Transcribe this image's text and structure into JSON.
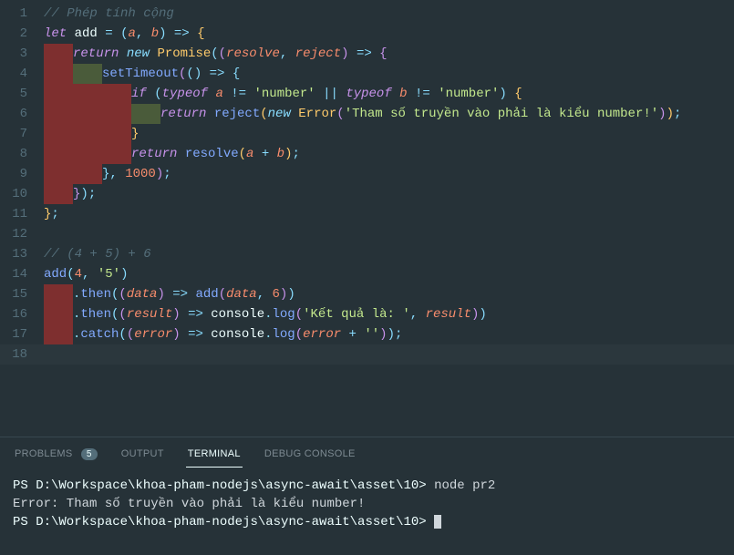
{
  "editor": {
    "lines": [
      {
        "n": 1,
        "segs": [
          [
            "comment",
            "// Phép tính cộng"
          ]
        ]
      },
      {
        "n": 2,
        "segs": [
          [
            "keyword",
            "let"
          ],
          [
            "sp",
            " "
          ],
          [
            "var",
            "add"
          ],
          [
            "sp",
            " "
          ],
          [
            "op",
            "="
          ],
          [
            "sp",
            " "
          ],
          [
            "punct",
            "("
          ],
          [
            "param",
            "a"
          ],
          [
            "punct",
            ","
          ],
          [
            "sp",
            " "
          ],
          [
            "param",
            "b"
          ],
          [
            "punct",
            ")"
          ],
          [
            "sp",
            " "
          ],
          [
            "op",
            "=>"
          ],
          [
            "sp",
            " "
          ],
          [
            "brace",
            "{"
          ]
        ]
      },
      {
        "n": 3,
        "indent": 1,
        "segs": [
          [
            "dirty1",
            1
          ],
          [
            "keyword",
            "return"
          ],
          [
            "sp",
            " "
          ],
          [
            "new",
            "new"
          ],
          [
            "sp",
            " "
          ],
          [
            "class",
            "Promise"
          ],
          [
            "punct",
            "("
          ],
          [
            "brace2",
            "("
          ],
          [
            "param",
            "resolve"
          ],
          [
            "punct",
            ","
          ],
          [
            "sp",
            " "
          ],
          [
            "param",
            "reject"
          ],
          [
            "brace2",
            ")"
          ],
          [
            "sp",
            " "
          ],
          [
            "op",
            "=>"
          ],
          [
            "sp",
            " "
          ],
          [
            "brace2",
            "{"
          ]
        ]
      },
      {
        "n": 4,
        "indent": 2,
        "segs": [
          [
            "dirty12",
            2
          ],
          [
            "func",
            "setTimeout"
          ],
          [
            "brace2",
            "("
          ],
          [
            "brace3",
            "("
          ],
          [
            "brace3",
            ")"
          ],
          [
            "sp",
            " "
          ],
          [
            "op",
            "=>"
          ],
          [
            "sp",
            " "
          ],
          [
            "brace3",
            "{"
          ]
        ]
      },
      {
        "n": 5,
        "indent": 3,
        "segs": [
          [
            "dirty1",
            3
          ],
          [
            "keyword",
            "if"
          ],
          [
            "sp",
            " "
          ],
          [
            "brace3",
            "("
          ],
          [
            "keyword",
            "typeof"
          ],
          [
            "sp",
            " "
          ],
          [
            "param",
            "a"
          ],
          [
            "sp",
            " "
          ],
          [
            "op",
            "!="
          ],
          [
            "sp",
            " "
          ],
          [
            "string",
            "'number'"
          ],
          [
            "sp",
            " "
          ],
          [
            "op",
            "||"
          ],
          [
            "sp",
            " "
          ],
          [
            "keyword",
            "typeof"
          ],
          [
            "sp",
            " "
          ],
          [
            "param",
            "b"
          ],
          [
            "sp",
            " "
          ],
          [
            "op",
            "!="
          ],
          [
            "sp",
            " "
          ],
          [
            "string",
            "'number'"
          ],
          [
            "brace3",
            ")"
          ],
          [
            "sp",
            " "
          ],
          [
            "brace",
            "{"
          ]
        ]
      },
      {
        "n": 6,
        "indent": 4,
        "segs": [
          [
            "dirty12",
            4
          ],
          [
            "keyword",
            "return"
          ],
          [
            "sp",
            " "
          ],
          [
            "func",
            "reject"
          ],
          [
            "brace",
            "("
          ],
          [
            "new",
            "new"
          ],
          [
            "sp",
            " "
          ],
          [
            "class",
            "Error"
          ],
          [
            "brace2",
            "("
          ],
          [
            "string",
            "'Tham số truyền vào phải là kiểu number!'"
          ],
          [
            "brace2",
            ")"
          ],
          [
            "brace",
            ")"
          ],
          [
            "punct",
            ";"
          ]
        ]
      },
      {
        "n": 7,
        "indent": 3,
        "segs": [
          [
            "dirty1",
            3
          ],
          [
            "brace",
            "}"
          ]
        ]
      },
      {
        "n": 8,
        "indent": 3,
        "segs": [
          [
            "dirty1",
            3
          ],
          [
            "keyword",
            "return"
          ],
          [
            "sp",
            " "
          ],
          [
            "func",
            "resolve"
          ],
          [
            "brace",
            "("
          ],
          [
            "param",
            "a"
          ],
          [
            "sp",
            " "
          ],
          [
            "op",
            "+"
          ],
          [
            "sp",
            " "
          ],
          [
            "param",
            "b"
          ],
          [
            "brace",
            ")"
          ],
          [
            "punct",
            ";"
          ]
        ]
      },
      {
        "n": 9,
        "indent": 2,
        "segs": [
          [
            "dirty1",
            2
          ],
          [
            "brace3",
            "}"
          ],
          [
            "punct",
            ","
          ],
          [
            "sp",
            " "
          ],
          [
            "num",
            "1000"
          ],
          [
            "brace2",
            ")"
          ],
          [
            "punct",
            ";"
          ]
        ]
      },
      {
        "n": 10,
        "indent": 1,
        "segs": [
          [
            "dirty1",
            1
          ],
          [
            "brace2",
            "}"
          ],
          [
            "punct",
            ")"
          ],
          [
            "punct",
            ";"
          ]
        ]
      },
      {
        "n": 11,
        "segs": [
          [
            "brace",
            "}"
          ],
          [
            "punct",
            ";"
          ]
        ]
      },
      {
        "n": 12,
        "segs": []
      },
      {
        "n": 13,
        "segs": [
          [
            "comment",
            "// (4 + 5) + 6"
          ]
        ]
      },
      {
        "n": 14,
        "segs": [
          [
            "func",
            "add"
          ],
          [
            "punct",
            "("
          ],
          [
            "num",
            "4"
          ],
          [
            "punct",
            ","
          ],
          [
            "sp",
            " "
          ],
          [
            "string",
            "'5'"
          ],
          [
            "punct",
            ")"
          ]
        ]
      },
      {
        "n": 15,
        "indent": 1,
        "segs": [
          [
            "dirty1",
            1
          ],
          [
            "punct",
            "."
          ],
          [
            "func",
            "then"
          ],
          [
            "punct",
            "("
          ],
          [
            "brace2",
            "("
          ],
          [
            "param",
            "data"
          ],
          [
            "brace2",
            ")"
          ],
          [
            "sp",
            " "
          ],
          [
            "op",
            "=>"
          ],
          [
            "sp",
            " "
          ],
          [
            "func",
            "add"
          ],
          [
            "brace2",
            "("
          ],
          [
            "param",
            "data"
          ],
          [
            "punct",
            ","
          ],
          [
            "sp",
            " "
          ],
          [
            "num",
            "6"
          ],
          [
            "brace2",
            ")"
          ],
          [
            "punct",
            ")"
          ]
        ]
      },
      {
        "n": 16,
        "indent": 1,
        "segs": [
          [
            "dirty1",
            1
          ],
          [
            "punct",
            "."
          ],
          [
            "func",
            "then"
          ],
          [
            "punct",
            "("
          ],
          [
            "brace2",
            "("
          ],
          [
            "param",
            "result"
          ],
          [
            "brace2",
            ")"
          ],
          [
            "sp",
            " "
          ],
          [
            "op",
            "=>"
          ],
          [
            "sp",
            " "
          ],
          [
            "var",
            "console"
          ],
          [
            "punct",
            "."
          ],
          [
            "func",
            "log"
          ],
          [
            "brace2",
            "("
          ],
          [
            "string",
            "'Kết quả là: '"
          ],
          [
            "punct",
            ","
          ],
          [
            "sp",
            " "
          ],
          [
            "param",
            "result"
          ],
          [
            "brace2",
            ")"
          ],
          [
            "punct",
            ")"
          ]
        ]
      },
      {
        "n": 17,
        "indent": 1,
        "segs": [
          [
            "dirty1",
            1
          ],
          [
            "punct",
            "."
          ],
          [
            "func",
            "catch"
          ],
          [
            "punct",
            "("
          ],
          [
            "brace2",
            "("
          ],
          [
            "param",
            "error"
          ],
          [
            "brace2",
            ")"
          ],
          [
            "sp",
            " "
          ],
          [
            "op",
            "=>"
          ],
          [
            "sp",
            " "
          ],
          [
            "var",
            "console"
          ],
          [
            "punct",
            "."
          ],
          [
            "func",
            "log"
          ],
          [
            "brace2",
            "("
          ],
          [
            "param",
            "error"
          ],
          [
            "sp",
            " "
          ],
          [
            "op",
            "+"
          ],
          [
            "sp",
            " "
          ],
          [
            "string",
            "''"
          ],
          [
            "brace2",
            ")"
          ],
          [
            "punct",
            ")"
          ],
          [
            "punct",
            ";"
          ]
        ]
      },
      {
        "n": 18,
        "hl": true,
        "segs": []
      }
    ]
  },
  "panel": {
    "tabs": {
      "problems": "PROBLEMS",
      "problems_count": "5",
      "output": "OUTPUT",
      "terminal": "TERMINAL",
      "debug": "DEBUG CONSOLE"
    },
    "terminal": {
      "line1_prompt": "PS D:\\Workspace\\khoa-pham-nodejs\\async-await\\asset\\10> ",
      "line1_cmd": "node pr2",
      "line2": "Error: Tham số truyền vào phải là kiểu number!",
      "line3_prompt": "PS D:\\Workspace\\khoa-pham-nodejs\\async-await\\asset\\10> "
    }
  }
}
